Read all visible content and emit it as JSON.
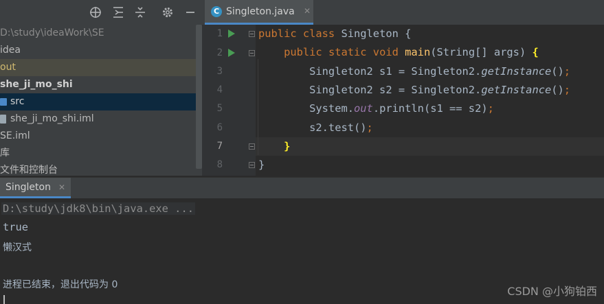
{
  "project_panel": {
    "toolbar_icons": [
      "locate-icon",
      "expand-all-icon",
      "collapse-all-icon",
      "settings-icon",
      "hide-icon"
    ],
    "tree": [
      {
        "label": "D:\\study\\ideaWork\\SE",
        "style": "path"
      },
      {
        "label": "idea",
        "style": "normal"
      },
      {
        "label": "out",
        "style": "muted-selected"
      },
      {
        "label": "she_ji_mo_shi",
        "style": "bold"
      },
      {
        "label": "src",
        "style": "selected",
        "icon": "folder-icon"
      },
      {
        "label": "she_ji_mo_shi.iml",
        "style": "normal",
        "icon": "module-file-icon"
      },
      {
        "label": "SE.iml",
        "style": "normal"
      },
      {
        "label": "库",
        "style": "normal"
      },
      {
        "label": "文件和控制台",
        "style": "normal"
      }
    ]
  },
  "editor": {
    "tab_label": "Singleton.java",
    "line_numbers": [
      "1",
      "2",
      "3",
      "4",
      "5",
      "6",
      "7",
      "8"
    ],
    "lines": [
      "public class Singleton {",
      "    public static void main(String[] args) {",
      "        Singleton2 s1 = Singleton2.getInstance();",
      "        Singleton2 s2 = Singleton2.getInstance();",
      "        System.out.println(s1 == s2);",
      "        s2.test();",
      "    }",
      "}"
    ],
    "current_line": 7
  },
  "run_panel": {
    "tab_label": "Singleton",
    "console": [
      "D:\\study\\jdk8\\bin\\java.exe ...",
      "true",
      "懒汉式",
      "",
      "进程已结束，退出代码为 0"
    ]
  },
  "watermark": "CSDN @小狗铂西"
}
